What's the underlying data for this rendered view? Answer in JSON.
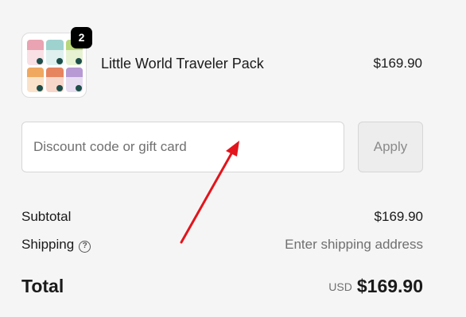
{
  "cart": {
    "item": {
      "name": "Little World Traveler Pack",
      "price": "$169.90",
      "quantity": "2",
      "pouch_colors": [
        "#e9a3b2",
        "#9ed2cf",
        "#b8d77a",
        "#f0a860",
        "#e6845f",
        "#b79ad4"
      ]
    }
  },
  "discount": {
    "placeholder": "Discount code or gift card",
    "value": "",
    "apply_label": "Apply"
  },
  "summary": {
    "subtotal_label": "Subtotal",
    "subtotal_value": "$169.90",
    "shipping_label": "Shipping",
    "shipping_help_glyph": "?",
    "shipping_value": "Enter shipping address",
    "total_label": "Total",
    "currency": "USD",
    "total_value": "$169.90"
  },
  "annotation": {
    "color": "#e3141b"
  }
}
